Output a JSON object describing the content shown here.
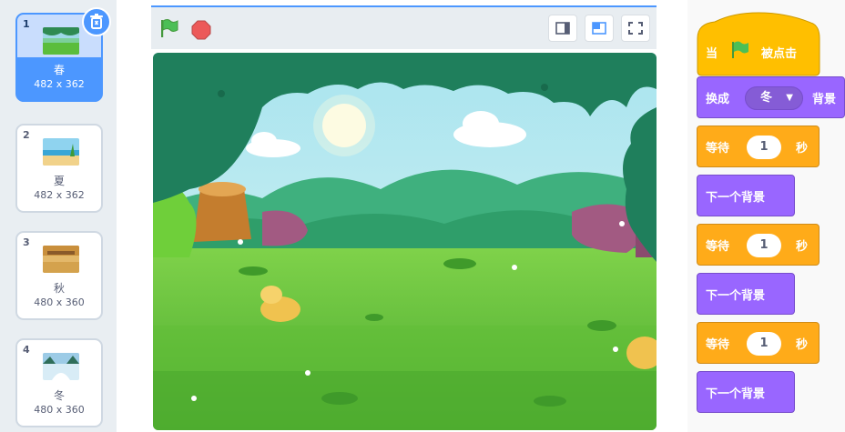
{
  "backdrops": [
    {
      "number": "1",
      "name": "春",
      "size": "482 x 362",
      "selected": true
    },
    {
      "number": "2",
      "name": "夏",
      "size": "482 x 362",
      "selected": false
    },
    {
      "number": "3",
      "name": "秋",
      "size": "480 x 360",
      "selected": false
    },
    {
      "number": "4",
      "name": "冬",
      "size": "480 x 360",
      "selected": false
    }
  ],
  "icons": {
    "delete": "trash-icon",
    "flag": "green-flag-icon",
    "stop": "stop-icon",
    "small_stage": "small-stage-icon",
    "large_stage": "large-stage-icon",
    "fullscreen": "fullscreen-icon"
  },
  "colors": {
    "selected": "#4c97ff",
    "events": "#ffab19",
    "looks": "#9966ff",
    "control": "#ffab19"
  },
  "code": {
    "hat": {
      "prefix": "当",
      "suffix": "被点击"
    },
    "switch": {
      "prefix": "换成",
      "value": "冬",
      "suffix": "背景"
    },
    "wait1": {
      "prefix": "等待",
      "value": "1",
      "suffix": "秒"
    },
    "next1": {
      "label": "下一个背景"
    },
    "wait2": {
      "prefix": "等待",
      "value": "1",
      "suffix": "秒"
    },
    "next2": {
      "label": "下一个背景"
    },
    "wait3": {
      "prefix": "等待",
      "value": "1",
      "suffix": "秒"
    },
    "next3": {
      "label": "下一个背景"
    }
  }
}
